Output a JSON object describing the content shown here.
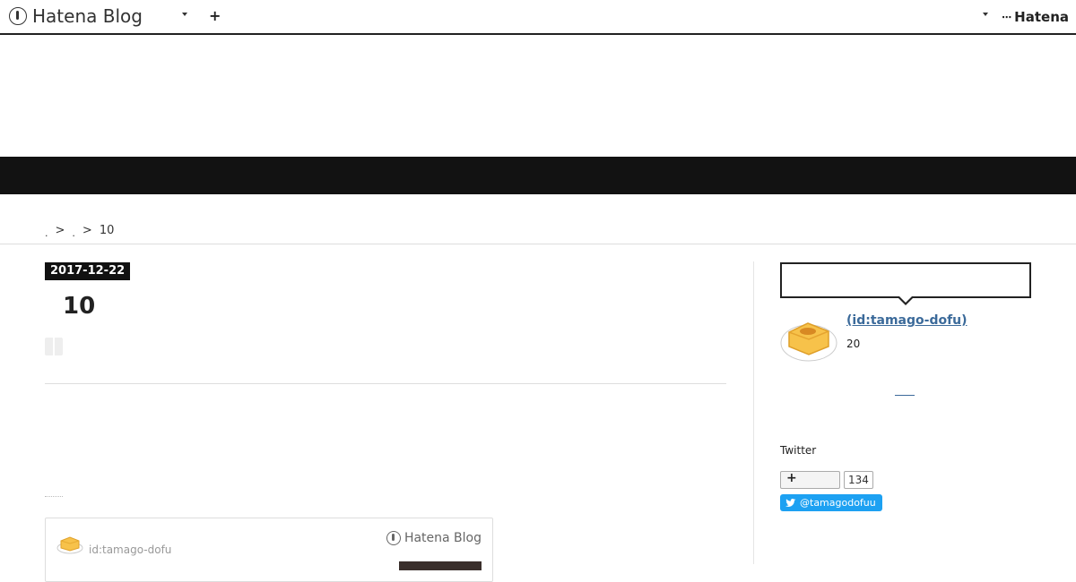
{
  "header": {
    "brand": "Hatena Blog",
    "plus_label": "+",
    "right_brand": "Hatena"
  },
  "breadcrumb": {
    "separator": ">",
    "current": "10"
  },
  "article": {
    "date": "2017-12-22",
    "title": "10"
  },
  "embed_card": {
    "user_id": "id:tamago-dofu",
    "brand": "Hatena Blog"
  },
  "sidebar": {
    "profile_name": " (id:tamago-dofu)",
    "profile_count": "20",
    "twitter_label": "Twitter",
    "follow_plus": "+",
    "follow_count": "134",
    "twitter_handle": "@tamagodofuu"
  },
  "colors": {
    "banner": "#121212",
    "link": "#3b6a9a",
    "twitter": "#1da1f2"
  }
}
